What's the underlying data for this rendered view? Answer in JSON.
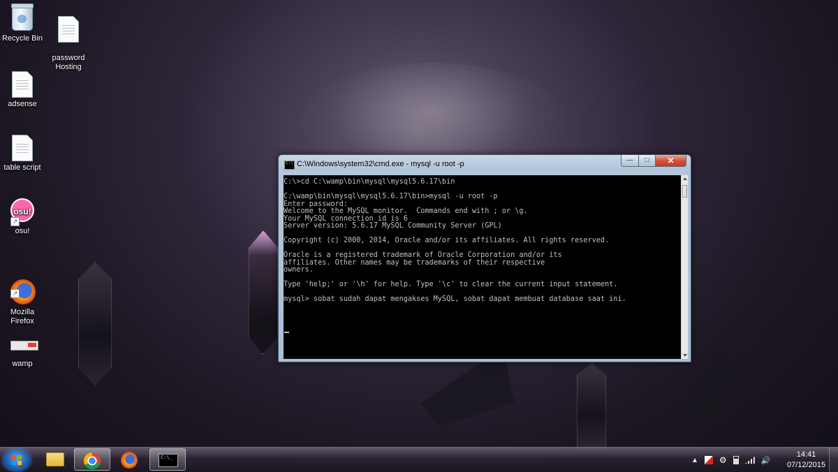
{
  "desktop": {
    "icons": [
      {
        "label": "Recycle Bin",
        "icon": "recycle-bin-icon"
      },
      {
        "label": "password\nHosting",
        "icon": "text-file-icon"
      },
      {
        "label": "adsense",
        "icon": "text-file-icon"
      },
      {
        "label": "table script",
        "icon": "text-file-icon"
      },
      {
        "label": "osu!",
        "icon": "osu-icon",
        "badge": "osu!"
      },
      {
        "label": "Mozilla\nFirefox",
        "icon": "firefox-icon"
      },
      {
        "label": "wamp",
        "icon": "wamp-icon"
      }
    ]
  },
  "cmd_window": {
    "title": "C:\\Windows\\system32\\cmd.exe - mysql  -u root -p",
    "controls": {
      "minimize": "—",
      "maximize": "□",
      "close": "✕"
    },
    "console_text": "C:\\>cd C:\\wamp\\bin\\mysql\\mysql5.6.17\\bin\n\nC:\\wamp\\bin\\mysql\\mysql5.6.17\\bin>mysql -u root -p\nEnter password:\nWelcome to the MySQL monitor.  Commands end with ; or \\g.\nYour MySQL connection id is 6\nServer version: 5.6.17 MySQL Community Server (GPL)\n\nCopyright (c) 2000, 2014, Oracle and/or its affiliates. All rights reserved.\n\nOracle is a registered trademark of Oracle Corporation and/or its\naffiliates. Other names may be trademarks of their respective\nowners.\n\nType 'help;' or '\\h' for help. Type '\\c' to clear the current input statement.\n\nmysql> sobat sudah dapat mengakses MySQL, sobat dapat membuat database saat ini."
  },
  "taskbar": {
    "pinned": [
      {
        "name": "windows-explorer",
        "icon": "folder-icon"
      },
      {
        "name": "google-chrome",
        "icon": "chrome-icon"
      },
      {
        "name": "mozilla-firefox",
        "icon": "firefox-icon"
      },
      {
        "name": "command-prompt",
        "icon": "cmd-icon",
        "active": true,
        "glyph": "C:\\_"
      }
    ],
    "tray": {
      "show_hidden": "▲",
      "volume": "🔊"
    },
    "clock": {
      "time": "14:41",
      "date": "07/12/2015"
    }
  }
}
